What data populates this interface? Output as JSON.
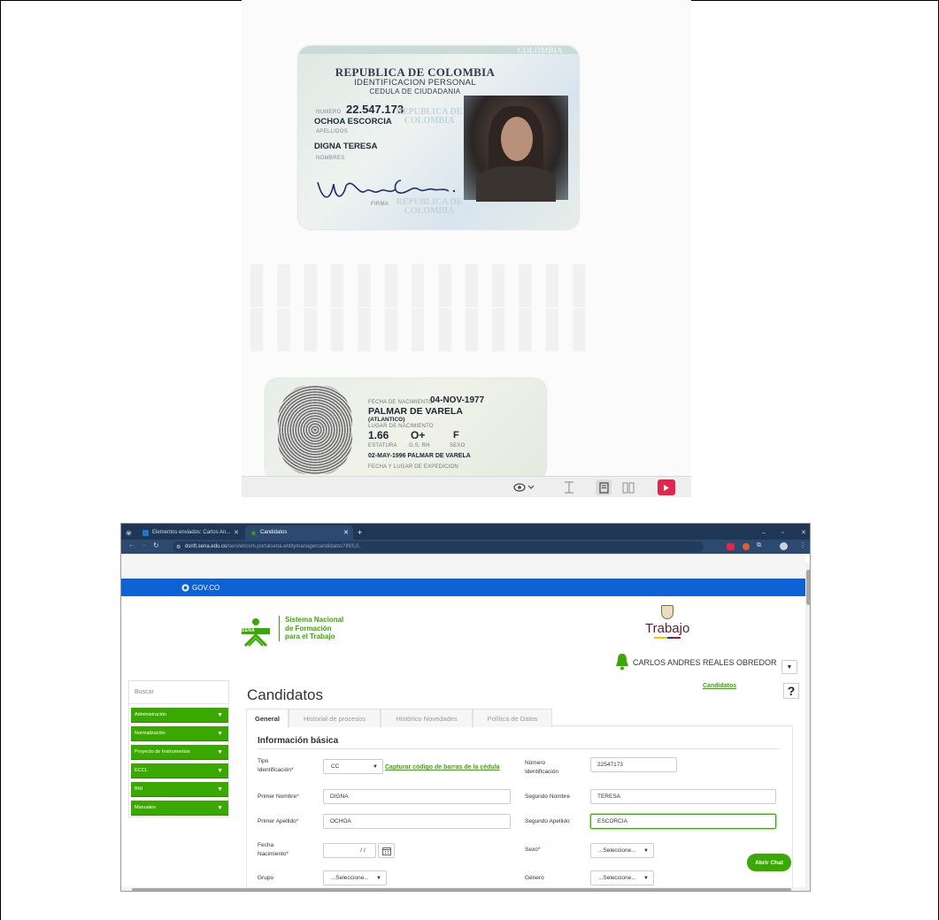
{
  "viewer": {
    "id_front": {
      "header1": "REPUBLICA DE COLOMBIA",
      "header2": "IDENTIFICACION PERSONAL",
      "header3": "CEDULA DE CIUDADANIA",
      "numero_label": "NUMERO",
      "numero": "22.547.173",
      "apellidos": "OCHOA ESCORCIA",
      "apellidos_label": "APELLIDOS",
      "nombres": "DIGNA TERESA",
      "nombres_label": "NOMBRES",
      "firma_label": "FIRMA",
      "watermark_top": "COLOMBIA",
      "watermark1": "REPUBLICA DE COLOMBIA",
      "watermark2": "REPUBLICA DE COLOMBIA"
    },
    "id_back": {
      "fecha_nac_label": "FECHA DE NACIMIENTO",
      "fecha_nac": "04-NOV-1977",
      "lugar_nac": "PALMAR DE VARELA",
      "lugar_nac_dept": "(ATLANTICO)",
      "lugar_nac_label": "LUGAR DE NACIMIENTO",
      "estatura": "1.66",
      "rh": "O+",
      "sexo": "F",
      "estatura_label": "ESTATURA",
      "rh_label": "G.S. RH",
      "sexo_label": "SEXO",
      "expedicion": "02-MAY-1996 PALMAR DE VARELA",
      "expedicion_label": "FECHA Y LUGAR DE EXPEDICION"
    },
    "toolbar_icons": [
      "eye-icon",
      "chevron-down-icon",
      "fit-height-icon",
      "single-page-icon",
      "two-page-icon",
      "play-icon"
    ],
    "accent_play": "#e0264a"
  },
  "browser": {
    "tabs": [
      {
        "label": "Elementos enviados: Carlos An...",
        "active": false
      },
      {
        "label": "Candidatos",
        "active": true
      }
    ],
    "url_host": "dsnft.sena.edu.co",
    "url_path": "/servlet/com.portalsena.entitymanagercandidatos?INS,0,",
    "gov_label": "GOV.CO",
    "brand_title_1": "Sistema Nacional",
    "brand_title_2": "de Formación",
    "brand_title_3": "para el Trabajo",
    "brand_acronym": "SENA",
    "ministry": "Trabajo",
    "user_name": "CARLOS ANDRES REALES OBREDOR",
    "user_dd": "▼",
    "search_placeholder": "Buscar",
    "menu": [
      {
        "label": "Administración"
      },
      {
        "label": "Normalización"
      },
      {
        "label": "Proyecto de Instrumentos"
      },
      {
        "label": "ECCL"
      },
      {
        "label": "BNI"
      },
      {
        "label": "Manuales"
      }
    ],
    "page_title": "Candidatos",
    "crumb": "Candidatos",
    "help": "?",
    "content_tabs": [
      {
        "label": "General",
        "active": true
      },
      {
        "label": "Historial de procesos",
        "active": false
      },
      {
        "label": "Histórico Novedades",
        "active": false
      },
      {
        "label": "Política de Datos",
        "active": false
      }
    ],
    "section_title": "Información básica",
    "fields": {
      "tipo_label_1": "Tipo",
      "tipo_label_2": "Identificación",
      "tipo_value": "CC",
      "barcode_link": "Capturar código de barras de la cédula",
      "numero_label_1": "Número",
      "numero_label_2": "Identificación",
      "numero_value": "22547173",
      "primer_nombre_label": "Primer Nombre",
      "primer_nombre_value": "DIGNA",
      "segundo_nombre_label": "Segundo Nombre",
      "segundo_nombre_value": "TERESA",
      "primer_apellido_label": "Primer Apellido",
      "primer_apellido_value": "OCHOA",
      "segundo_apellido_label": "Segundo Apellido",
      "segundo_apellido_value": "ESCORCIA",
      "fecha_label_1": "Fecha",
      "fecha_label_2": "Nacimiento",
      "fecha_value": "/ /",
      "sexo_label": "Sexo",
      "sexo_value": "...Seleccione...",
      "grupo_label": "Grupo",
      "grupo_value": "...Seleccione...",
      "genero_label": "Género",
      "genero_value": "...Seleccione...",
      "required_mark": "*"
    },
    "chat_button": "Abrir Chat",
    "brand_color": "#39a900",
    "gov_color": "#0f62d6"
  }
}
